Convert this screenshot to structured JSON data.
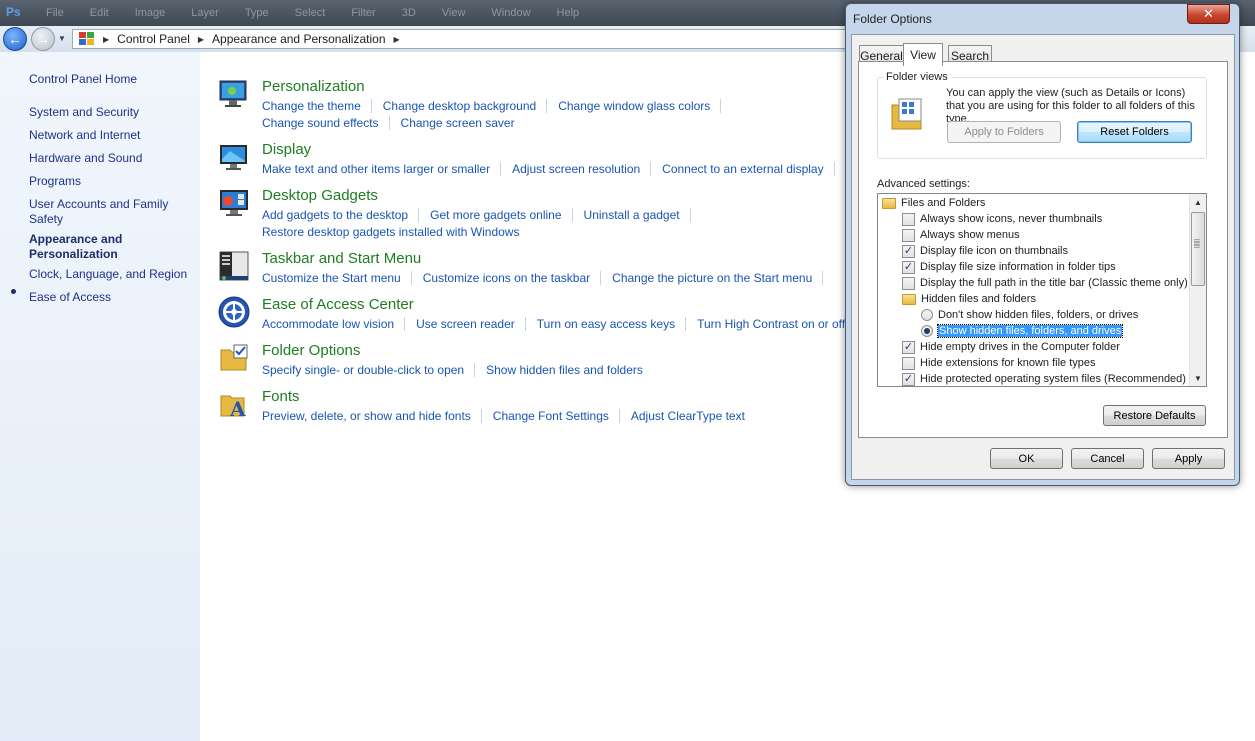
{
  "topbar": {
    "app_badge": "Ps",
    "menu": [
      "File",
      "Edit",
      "Image",
      "Layer",
      "Type",
      "Select",
      "Filter",
      "3D",
      "View",
      "Window",
      "Help"
    ]
  },
  "address": {
    "crumb1": "Control Panel",
    "crumb2": "Appearance and Personalization"
  },
  "sidebar": {
    "home": "Control Panel Home",
    "items": [
      "System and Security",
      "Network and Internet",
      "Hardware and Sound",
      "Programs",
      "User Accounts and Family Safety",
      "Appearance and Personalization",
      "Clock, Language, and Region",
      "Ease of Access"
    ]
  },
  "categories": [
    {
      "title": "Personalization",
      "rows": [
        [
          "Change the theme",
          "Change desktop background",
          "Change window glass colors"
        ],
        [
          "Change sound effects",
          "Change screen saver"
        ]
      ]
    },
    {
      "title": "Display",
      "rows": [
        [
          "Make text and other items larger or smaller",
          "Adjust screen resolution",
          "Connect to an external display"
        ]
      ]
    },
    {
      "title": "Desktop Gadgets",
      "rows": [
        [
          "Add gadgets to the desktop",
          "Get more gadgets online",
          "Uninstall a gadget"
        ],
        [
          "Restore desktop gadgets installed with Windows"
        ]
      ]
    },
    {
      "title": "Taskbar and Start Menu",
      "rows": [
        [
          "Customize the Start menu",
          "Customize icons on the taskbar",
          "Change the picture on the Start menu"
        ]
      ]
    },
    {
      "title": "Ease of Access Center",
      "rows": [
        [
          "Accommodate low vision",
          "Use screen reader",
          "Turn on easy access keys",
          "Turn High Contrast on or off"
        ]
      ]
    },
    {
      "title": "Folder Options",
      "rows": [
        [
          "Specify single- or double-click to open",
          "Show hidden files and folders"
        ]
      ]
    },
    {
      "title": "Fonts",
      "rows": [
        [
          "Preview, delete, or show and hide fonts",
          "Change Font Settings",
          "Adjust ClearType text"
        ]
      ]
    }
  ],
  "dialog": {
    "title": "Folder Options",
    "close": "✕",
    "tabs": [
      "General",
      "View",
      "Search"
    ],
    "folder_views_label": "Folder views",
    "folder_views_text": "You can apply the view (such as Details or Icons) that you are using for this folder to all folders of this type.",
    "apply_to_folders": "Apply to Folders",
    "reset_folders": "Reset Folders",
    "advanced_label": "Advanced settings:",
    "tree": [
      {
        "kind": "folder",
        "label": "Files and Folders",
        "indent": 0
      },
      {
        "kind": "check",
        "checked": false,
        "label": "Always show icons, never thumbnails",
        "indent": 1
      },
      {
        "kind": "check",
        "checked": false,
        "label": "Always show menus",
        "indent": 1
      },
      {
        "kind": "check",
        "checked": true,
        "label": "Display file icon on thumbnails",
        "indent": 1
      },
      {
        "kind": "check",
        "checked": true,
        "label": "Display file size information in folder tips",
        "indent": 1
      },
      {
        "kind": "check",
        "checked": false,
        "label": "Display the full path in the title bar (Classic theme only)",
        "indent": 1
      },
      {
        "kind": "folder",
        "label": "Hidden files and folders",
        "indent": 1
      },
      {
        "kind": "radio",
        "checked": false,
        "label": "Don't show hidden files, folders, or drives",
        "indent": 2
      },
      {
        "kind": "radio",
        "checked": true,
        "label": "Show hidden files, folders, and drives",
        "indent": 2,
        "selected": true
      },
      {
        "kind": "check",
        "checked": true,
        "label": "Hide empty drives in the Computer folder",
        "indent": 1
      },
      {
        "kind": "check",
        "checked": false,
        "label": "Hide extensions for known file types",
        "indent": 1
      },
      {
        "kind": "check",
        "checked": true,
        "label": "Hide protected operating system files (Recommended)",
        "indent": 1
      }
    ],
    "restore_defaults": "Restore Defaults",
    "ok": "OK",
    "cancel": "Cancel",
    "apply": "Apply"
  }
}
